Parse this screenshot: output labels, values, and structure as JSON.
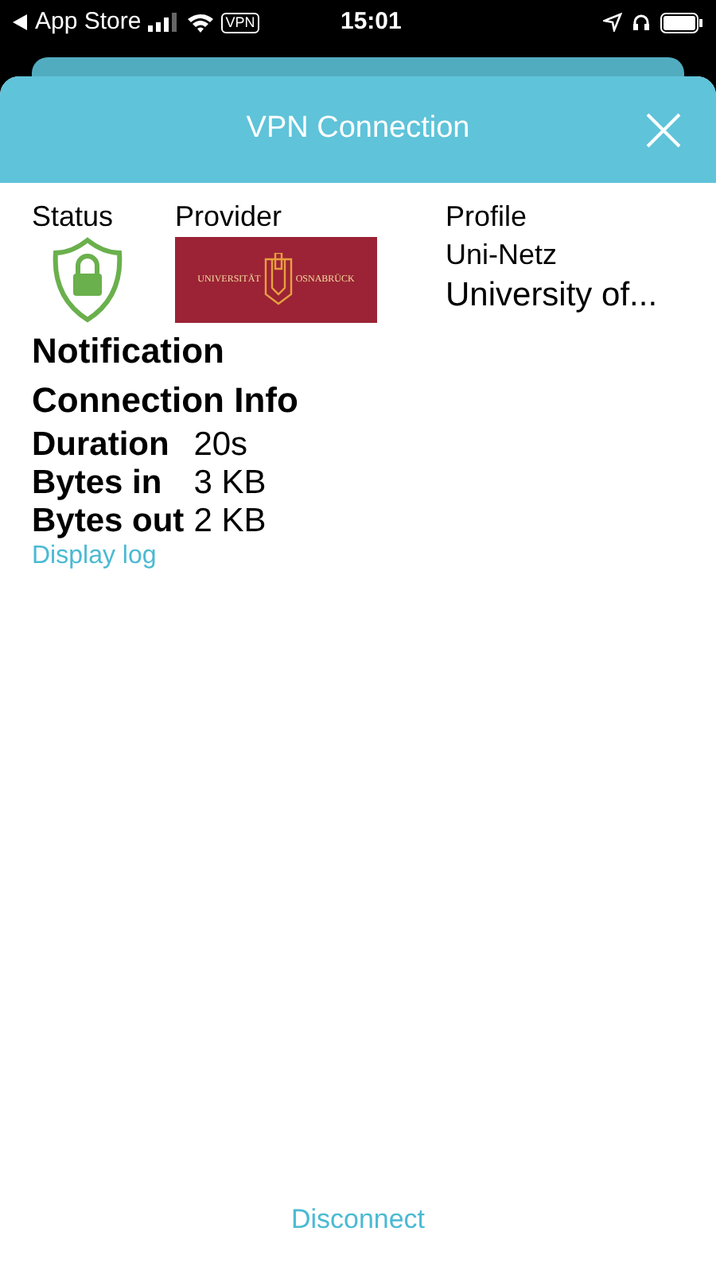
{
  "status_bar": {
    "back_label": "App Store",
    "vpn_badge": "VPN",
    "time": "15:01"
  },
  "header": {
    "title": "VPN Connection"
  },
  "columns": {
    "status": {
      "label": "Status"
    },
    "provider": {
      "label": "Provider",
      "logo_left": "UNIVERSITÄT",
      "logo_right": "OSNABRÜCK"
    },
    "profile": {
      "label": "Profile",
      "name": "Uni-Netz",
      "organization": "University of..."
    }
  },
  "notification": {
    "title": "Notification"
  },
  "connection_info": {
    "title": "Connection Info",
    "rows": [
      {
        "label": "Duration",
        "value": "20s"
      },
      {
        "label": "Bytes in",
        "value": "3 KB"
      },
      {
        "label": "Bytes out",
        "value": "2 KB"
      }
    ],
    "log_link": "Display log"
  },
  "footer": {
    "action": "Disconnect"
  }
}
